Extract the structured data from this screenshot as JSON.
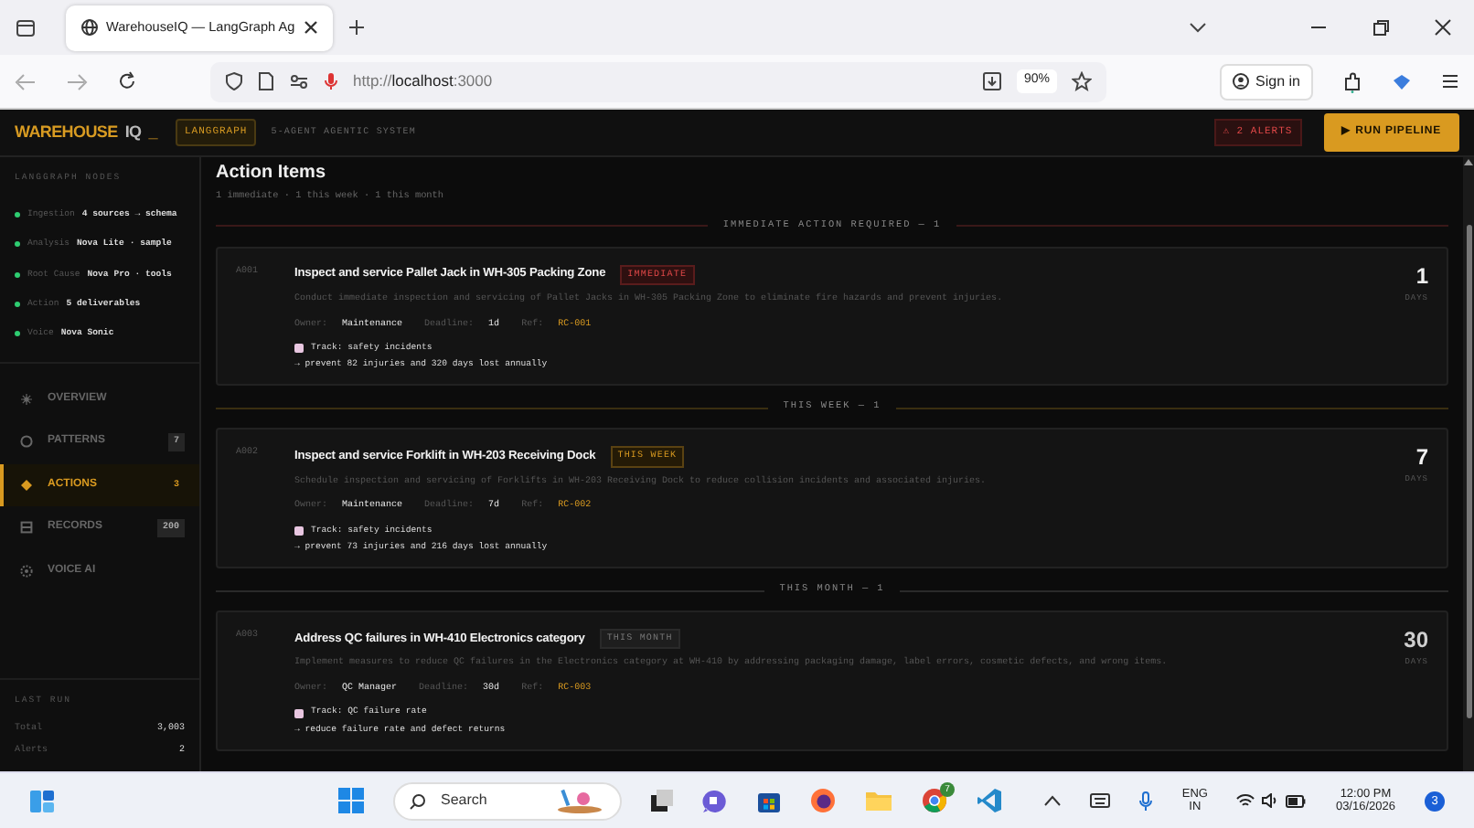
{
  "browser": {
    "tab_title": "WarehouseIQ — LangGraph Ag",
    "url": "http://**localhost**:3000",
    "zoom": "90%",
    "sign_in": "Sign in"
  },
  "app_header": {
    "logo": "WAREHOUSE",
    "logo_suffix": "IQ",
    "cursor": "_",
    "badge": "LANGGRAPH",
    "subtitle": "5-AGENT AGENTIC SYSTEM",
    "alerts": "⚠ 2 ALERTS",
    "run_button": "▶ RUN PIPELINE"
  },
  "sidebar": {
    "nodes_heading": "LANGGRAPH NODES",
    "nodes": [
      {
        "name": "Ingestion",
        "detail": "4 sources → schema"
      },
      {
        "name": "Analysis",
        "detail": "Nova Lite · sample"
      },
      {
        "name": "Root Cause",
        "detail": "Nova Pro · tools"
      },
      {
        "name": "Action",
        "detail": "5 deliverables"
      },
      {
        "name": "Voice",
        "detail": "Nova Sonic"
      }
    ],
    "nav": [
      {
        "label": "OVERVIEW",
        "selected": false
      },
      {
        "label": "PATTERNS",
        "count": "7",
        "selected": false
      },
      {
        "label": "ACTIONS",
        "count": "3",
        "selected": true
      },
      {
        "label": "RECORDS",
        "count": "200",
        "selected": false
      },
      {
        "label": "VOICE AI",
        "selected": false
      }
    ],
    "last_run": {
      "heading": "LAST RUN",
      "stats": [
        {
          "label": "Total",
          "value": "3,003"
        },
        {
          "label": "Alerts",
          "value": "2"
        }
      ]
    }
  },
  "main": {
    "title": "Action Items",
    "summary": "1 immediate · 1 this week · 1 this month",
    "sections": [
      {
        "kind": "immediate",
        "heading": "IMMEDIATE ACTION REQUIRED — 1",
        "items": [
          {
            "id": "A001",
            "title": "Inspect and service Pallet Jack in WH-305 Packing Zone",
            "badge": "IMMEDIATE",
            "description": "Conduct immediate inspection and servicing of Pallet Jacks in WH-305 Packing Zone to eliminate fire hazards and prevent injuries.",
            "owner_label": "Owner:",
            "owner": "Maintenance",
            "deadline_label": "Deadline:",
            "deadline": "1d",
            "ref_label": "Ref:",
            "ref": "RC-001",
            "track": "Track: safety incidents",
            "benefit": "→ prevent 82 injuries and 320 days lost annually",
            "days": "1",
            "days_label": "DAYS"
          }
        ]
      },
      {
        "kind": "week",
        "heading": "THIS WEEK — 1",
        "items": [
          {
            "id": "A002",
            "title": "Inspect and service Forklift in WH-203 Receiving Dock",
            "badge": "THIS WEEK",
            "description": "Schedule inspection and servicing of Forklifts in WH-203 Receiving Dock to reduce collision incidents and associated injuries.",
            "owner_label": "Owner:",
            "owner": "Maintenance",
            "deadline_label": "Deadline:",
            "deadline": "7d",
            "ref_label": "Ref:",
            "ref": "RC-002",
            "track": "Track: safety incidents",
            "benefit": "→ prevent 73 injuries and 216 days lost annually",
            "days": "7",
            "days_label": "DAYS"
          }
        ]
      },
      {
        "kind": "month",
        "heading": "THIS MONTH — 1",
        "items": [
          {
            "id": "A003",
            "title": "Address QC failures in WH-410 Electronics category",
            "badge": "THIS MONTH",
            "description": "Implement measures to reduce QC failures in the Electronics category at WH-410 by addressing packaging damage, label errors, cosmetic defects, and wrong items.",
            "owner_label": "Owner:",
            "owner": "QC Manager",
            "deadline_label": "Deadline:",
            "deadline": "30d",
            "ref_label": "Ref:",
            "ref": "RC-003",
            "track": "Track: QC failure rate",
            "benefit": "→ reduce failure rate and defect returns",
            "days": "30",
            "days_label": "DAYS"
          }
        ]
      }
    ]
  },
  "taskbar": {
    "search": "Search",
    "chrome_badge": "7",
    "lang": "ENG",
    "region": "IN",
    "time": "12:00 PM",
    "date": "03/16/2026",
    "notifications": "3"
  }
}
